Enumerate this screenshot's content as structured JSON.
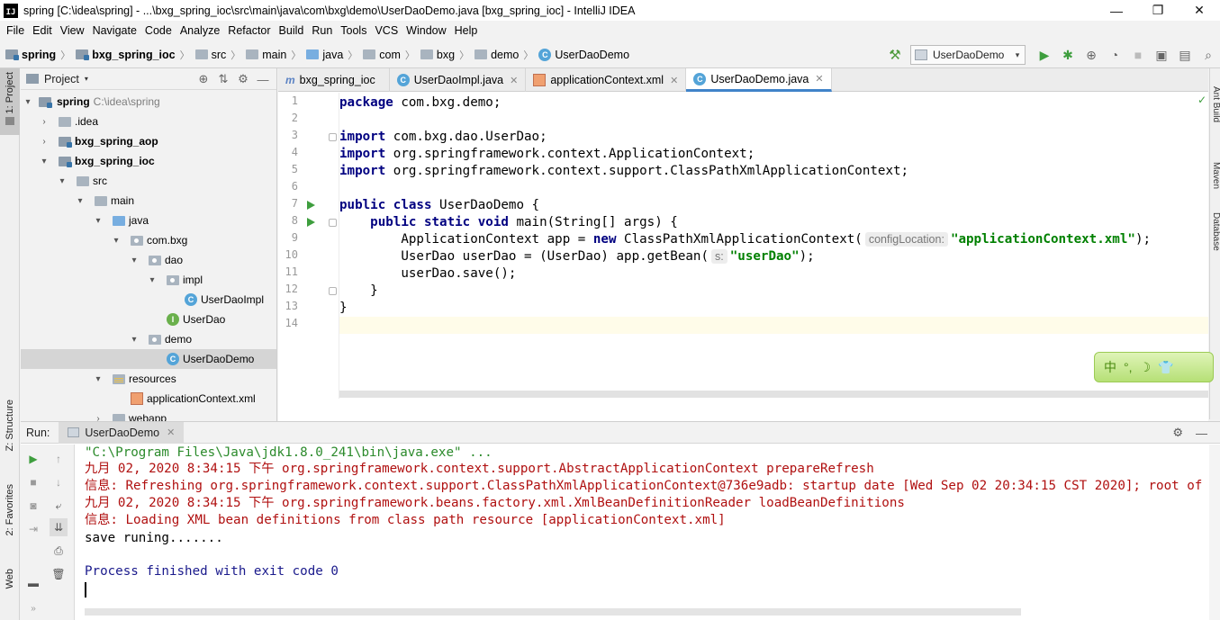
{
  "window": {
    "title": "spring [C:\\idea\\spring] - ...\\bxg_spring_ioc\\src\\main\\java\\com\\bxg\\demo\\UserDaoDemo.java [bxg_spring_ioc] - IntelliJ IDEA",
    "app_icon_text": "IJ",
    "minimize": "—",
    "restore": "❐",
    "close": "✕"
  },
  "menu": [
    "File",
    "Edit",
    "View",
    "Navigate",
    "Code",
    "Analyze",
    "Refactor",
    "Build",
    "Run",
    "Tools",
    "VCS",
    "Window",
    "Help"
  ],
  "breadcrumb": {
    "items": [
      "spring",
      "bxg_spring_ioc",
      "src",
      "main",
      "java",
      "com",
      "bxg",
      "demo",
      "UserDaoDemo"
    ],
    "separator": "〉"
  },
  "toolbar": {
    "run_config": "UserDaoDemo",
    "dropdown_icon": "▾",
    "hammer_icon": "⚒",
    "run_icon": "▶",
    "debug_icon": "✱",
    "coverage_icon": "⊕",
    "profile_icon": "◔",
    "stop_icon": "■",
    "project_structure_icon": "▣",
    "terminal_icon": "▤",
    "search_icon": "⌕"
  },
  "left_stripe": {
    "project": "1: Project",
    "structure": "Z: Structure",
    "favorites": "2: Favorites",
    "web": "Web"
  },
  "right_stripe": {
    "ant": "Ant Build",
    "maven": "Maven",
    "database": "Database"
  },
  "project_panel": {
    "title": "Project",
    "caret": "▾",
    "tools": [
      "⊕",
      "⇅",
      "⚙",
      "—"
    ],
    "tree": [
      {
        "label": "spring",
        "path": "C:\\idea\\spring",
        "bold": true,
        "arrow": "▾"
      },
      {
        "label": ".idea",
        "arrow": "›"
      },
      {
        "label": "bxg_spring_aop",
        "bold": true,
        "arrow": "›"
      },
      {
        "label": "bxg_spring_ioc",
        "bold": true,
        "arrow": "▾"
      },
      {
        "label": "src",
        "arrow": "▾"
      },
      {
        "label": "main",
        "arrow": "▾"
      },
      {
        "label": "java",
        "arrow": "▾"
      },
      {
        "label": "com.bxg",
        "arrow": "▾"
      },
      {
        "label": "dao",
        "arrow": "▾"
      },
      {
        "label": "impl",
        "arrow": "▾"
      },
      {
        "label": "UserDaoImpl",
        "icon_letter": "C"
      },
      {
        "label": "UserDao",
        "icon_letter": "I"
      },
      {
        "label": "demo",
        "arrow": "▾"
      },
      {
        "label": "UserDaoDemo",
        "icon_letter": "C"
      },
      {
        "label": "resources",
        "arrow": "▾"
      },
      {
        "label": "applicationContext.xml",
        "icon_letter": "xml"
      },
      {
        "label": "webapp",
        "arrow": "›"
      }
    ]
  },
  "editor": {
    "tabs": [
      {
        "icon": "m",
        "label": "bxg_spring_ioc",
        "close": ""
      },
      {
        "icon": "C",
        "label": "UserDaoImpl.java",
        "close": "✕"
      },
      {
        "icon": "xml",
        "label": "applicationContext.xml",
        "close": "✕"
      },
      {
        "icon": "C",
        "label": "UserDaoDemo.java",
        "close": "✕"
      }
    ],
    "line_numbers": [
      "1",
      "2",
      "3",
      "4",
      "5",
      "6",
      "7",
      "8",
      "9",
      "10",
      "11",
      "12",
      "13",
      "14"
    ],
    "lines": {
      "l1_kw": "package",
      "l1_rest": " com.bxg.demo;",
      "l3_kw": "import",
      "l3_rest": " com.bxg.dao.UserDao;",
      "l4_kw": "import",
      "l4_rest": " org.springframework.context.ApplicationContext;",
      "l5_kw": "import",
      "l5_rest": " org.springframework.context.support.ClassPathXmlApplicationContext;",
      "l7_kw": "public class",
      "l7_rest": " UserDaoDemo {",
      "l8_indent": "    ",
      "l8_kw": "public static void",
      "l8_rest": " main(String[] args) {",
      "l9_a": "        ApplicationContext app = ",
      "l9_kw": "new",
      "l9_b": " ClassPathXmlApplicationContext(",
      "l9_hint": "configLocation:",
      "l9_str": "\"applicationContext.xml\"",
      "l9_end": ");",
      "l10_a": "        UserDao userDao = (UserDao) app.getBean(",
      "l10_hint": "s:",
      "l10_str": "\"userDao\"",
      "l10_end": ");",
      "l11": "        userDao.save();",
      "l12": "    }",
      "l13": "}"
    },
    "status_check": "✓"
  },
  "ime": {
    "items": [
      "中",
      "°,",
      "☽",
      "👕"
    ]
  },
  "run_panel": {
    "label": "Run:",
    "tab": "UserDaoDemo",
    "tab_close": "✕",
    "header_tools": [
      "⚙",
      "—"
    ],
    "toolbar": {
      "rerun": "▶",
      "up": "↑",
      "stop": "■",
      "down": "↓",
      "camera": "◙",
      "wrap": "⤶",
      "exit": "⇥",
      "scroll_end": "⇊",
      "layout": "▬",
      "print": "⎙",
      "trash": "🗑",
      "more": "»"
    },
    "console": [
      {
        "text": "\"C:\\Program Files\\Java\\jdk1.8.0_241\\bin\\java.exe\" ...",
        "kind": "cmd"
      },
      {
        "text": "九月 02, 2020 8:34:15 下午 org.springframework.context.support.AbstractApplicationContext prepareRefresh",
        "kind": "err"
      },
      {
        "text": "信息: Refreshing org.springframework.context.support.ClassPathXmlApplicationContext@736e9adb: startup date [Wed Sep 02 20:34:15 CST 2020]; root of context hierarchy",
        "kind": "err"
      },
      {
        "text": "九月 02, 2020 8:34:15 下午 org.springframework.beans.factory.xml.XmlBeanDefinitionReader loadBeanDefinitions",
        "kind": "err"
      },
      {
        "text": "信息: Loading XML bean definitions from class path resource [applicationContext.xml]",
        "kind": "err"
      },
      {
        "text": "save runing.......",
        "kind": "out"
      },
      {
        "text": "",
        "kind": "out"
      },
      {
        "text": "Process finished with exit code 0",
        "kind": "exit"
      }
    ]
  },
  "colors": {
    "keyword": "#000080",
    "string": "#008000",
    "console_error": "#b01010",
    "console_cmd": "#2b8a2b",
    "accent_tab": "#4083c9",
    "run_green": "#3e9e3e"
  }
}
